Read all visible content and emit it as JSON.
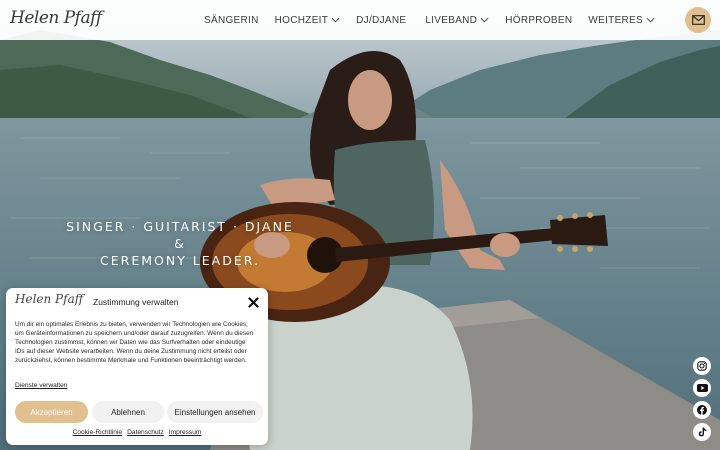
{
  "header": {
    "logo": "Helen Pfaff",
    "nav": [
      {
        "label": "SÄNGERIN",
        "dropdown": false
      },
      {
        "label": "HOCHZEIT",
        "dropdown": true
      },
      {
        "label": "DJ/DJANE",
        "dropdown": false
      },
      {
        "label": "LIVEBAND",
        "dropdown": true
      },
      {
        "label": "HÖRPROBEN",
        "dropdown": false
      },
      {
        "label": "WEITERES",
        "dropdown": true
      }
    ],
    "mail_icon": "mail-icon"
  },
  "hero": {
    "tagline_line1": "SINGER · GUITARIST · DJANE &",
    "tagline_line2": "CEREMONY LEADER."
  },
  "social": [
    {
      "name": "instagram-icon"
    },
    {
      "name": "youtube-icon"
    },
    {
      "name": "facebook-icon"
    },
    {
      "name": "tiktok-icon"
    }
  ],
  "cookie": {
    "logo": "Helen Pfaff",
    "title": "Zustimmung verwalten",
    "text": "Um dir ein optimales Erlebnis zu bieten, verwenden wir Technologien wie Cookies, um Geräteinformationen zu speichern und/oder darauf zuzugreifen. Wenn du diesen Technologien zustimmst, können wir Daten wie das Surfverhalten oder eindeutige IDs auf dieser Website verarbeiten. Wenn du deine Zustimmung nicht erteilst oder zurückziehst, können bestimmte Merkmale und Funktionen beeinträchtigt werden.",
    "services_link": "Dienste verwalten",
    "accept": "Akzeptieren",
    "deny": "Ablehnen",
    "preferences": "Einstellungen ansehen",
    "footer": [
      "Cookie-Richtlinie",
      "Datenschutz",
      "Impressum"
    ]
  },
  "colors": {
    "accent": "#e2bf8f",
    "header_bg": "#ffffff",
    "text_dark": "#3b3b3b"
  }
}
